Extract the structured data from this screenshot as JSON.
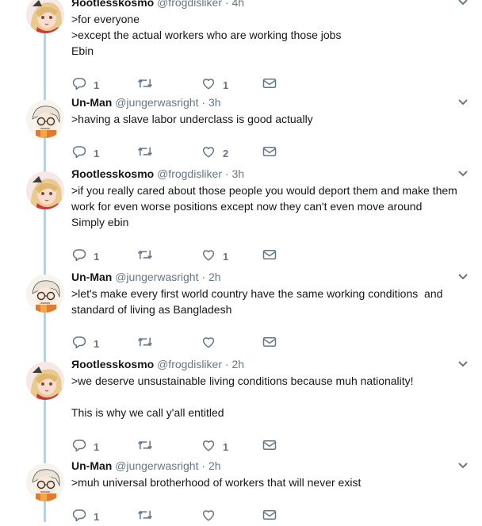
{
  "tweets": [
    {
      "name": "Яootlesskosmo",
      "handle": "@frogdisliker",
      "dot": "·",
      "time": "4h",
      "avatar": "anime-girl-avatar",
      "lines": [
        ">for everyone",
        ">except the actual workers who are working those jobs",
        "Ebin"
      ],
      "replies": "1",
      "retweets": "",
      "likes": "1"
    },
    {
      "name": "Un-Man",
      "handle": "@jungerwasright",
      "dot": "·",
      "time": "3h",
      "avatar": "glasses-anime-avatar",
      "lines": [
        ">having a slave labor underclass is good actually"
      ],
      "replies": "1",
      "retweets": "",
      "likes": "2"
    },
    {
      "name": "Яootlesskosmo",
      "handle": "@frogdisliker",
      "dot": "·",
      "time": "3h",
      "avatar": "anime-girl-avatar",
      "lines": [
        ">if you really cared about those people you would deport them and make them",
        "work for even worse positions except now they can't even move around",
        "Simply ebin"
      ],
      "replies": "1",
      "retweets": "",
      "likes": "1"
    },
    {
      "name": "Un-Man",
      "handle": "@jungerwasright",
      "dot": "·",
      "time": "2h",
      "avatar": "glasses-anime-avatar",
      "lines": [
        ">let's make every first world country have the same working conditions  and",
        "standard of living as Bangladesh"
      ],
      "replies": "1",
      "retweets": "",
      "likes": ""
    },
    {
      "name": "Яootlesskosmo",
      "handle": "@frogdisliker",
      "dot": "·",
      "time": "2h",
      "avatar": "anime-girl-avatar",
      "lines": [
        ">we deserve unsustainable living conditions because muh nationality!",
        "",
        "This is why we call y'all entitled"
      ],
      "replies": "1",
      "retweets": "",
      "likes": "1"
    },
    {
      "name": "Un-Man",
      "handle": "@jungerwasright",
      "dot": "·",
      "time": "2h",
      "avatar": "glasses-anime-avatar",
      "lines": [
        ">muh universal brotherhood of workers that will never exist"
      ],
      "replies": "1",
      "retweets": "",
      "likes": ""
    }
  ],
  "icons": {
    "reply": "reply-icon",
    "retweet": "retweet-icon",
    "like": "heart-icon",
    "dm": "envelope-icon",
    "more": "chevron-down-icon"
  },
  "colors": {
    "thread_line": "#a9d6f5",
    "meta_text": "#657786",
    "primary_text": "#14171a"
  }
}
